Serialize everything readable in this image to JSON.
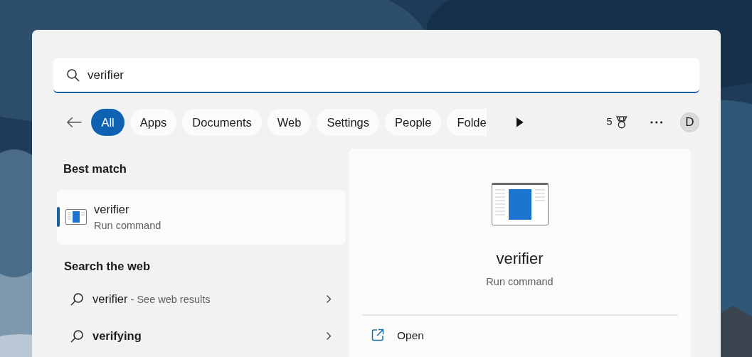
{
  "search": {
    "value": "verifier"
  },
  "filters": [
    {
      "label": "All",
      "selected": true
    },
    {
      "label": "Apps",
      "selected": false
    },
    {
      "label": "Documents",
      "selected": false
    },
    {
      "label": "Web",
      "selected": false
    },
    {
      "label": "Settings",
      "selected": false
    },
    {
      "label": "People",
      "selected": false
    },
    {
      "label": "Folde",
      "selected": false
    }
  ],
  "points": "5",
  "avatar": "D",
  "best_match": {
    "heading": "Best match",
    "title": "verifier",
    "subtitle": "Run command",
    "selected": true
  },
  "web": {
    "heading": "Search the web",
    "items": [
      {
        "kind": "web-results",
        "query": "verifier",
        "suffix": " - See web results"
      },
      {
        "kind": "suggestion",
        "query": "verifying"
      }
    ]
  },
  "detail": {
    "title": "verifier",
    "subtitle": "Run command",
    "actions": [
      "Open"
    ]
  }
}
